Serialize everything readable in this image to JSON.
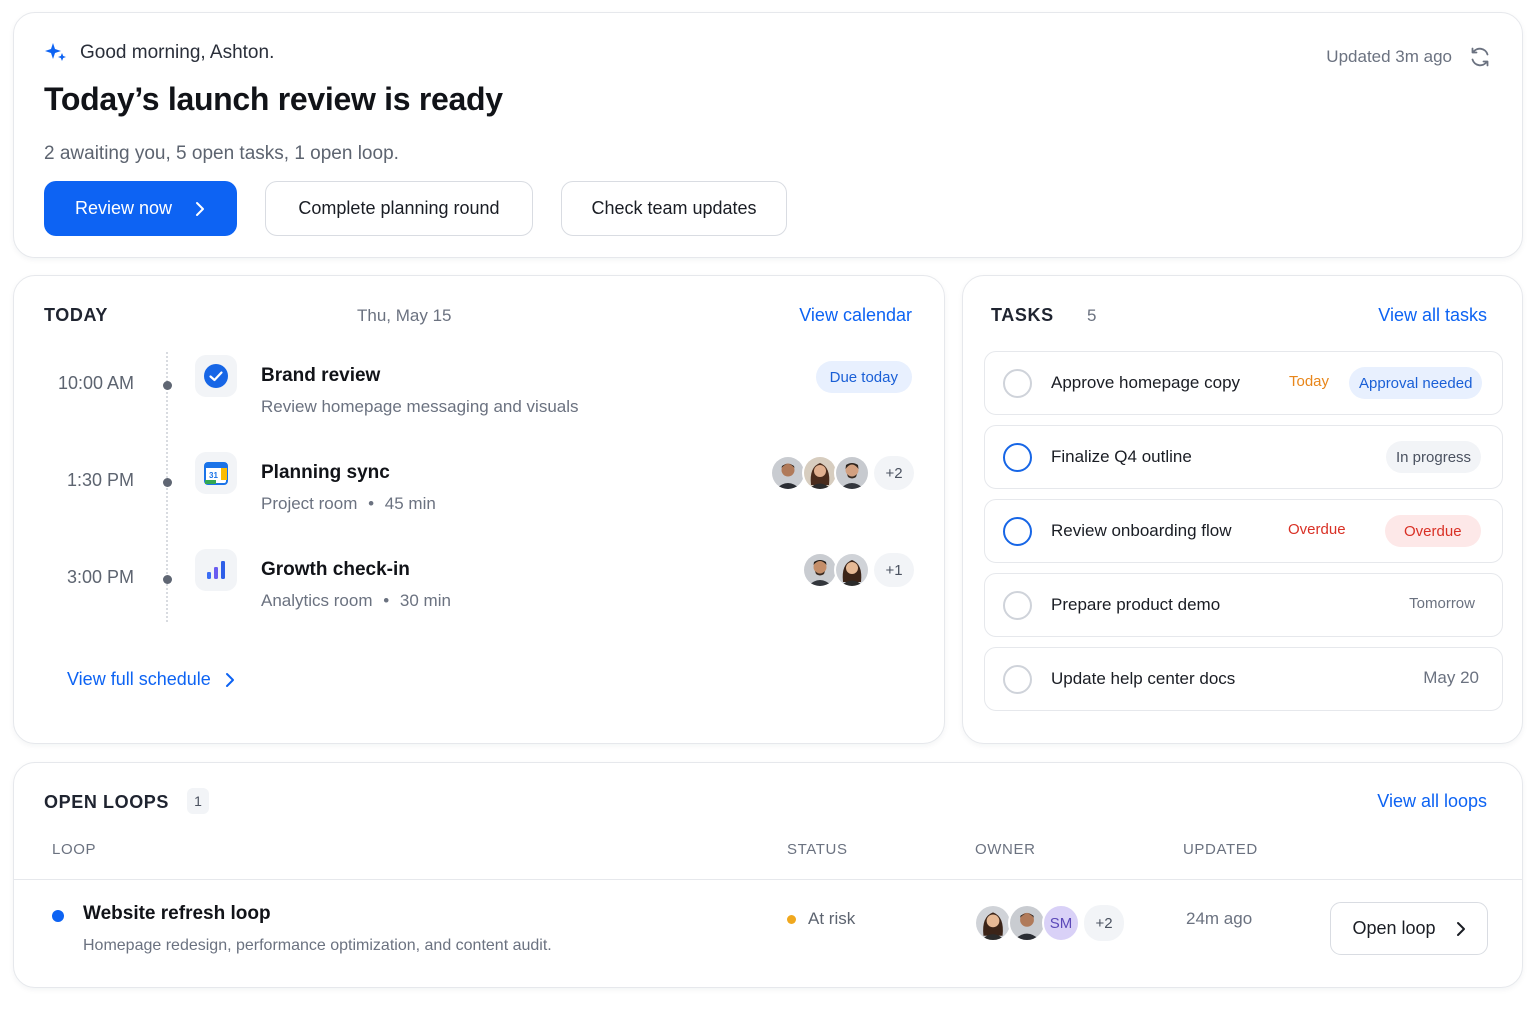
{
  "hero": {
    "greeting": "Good morning, Ashton.",
    "title": "Today’s launch review is ready",
    "subtitle": "2 awaiting you, 5 open tasks, 1 open loop.",
    "updated": "Updated 3m ago",
    "primary_button": "Review now",
    "secondary_buttons": [
      "Complete planning round",
      "Check team updates"
    ],
    "accent": "#0d63f3"
  },
  "today": {
    "title": "TODAY",
    "date": "Thu, May 15",
    "link": "View calendar",
    "events": [
      {
        "time": "10:00 AM",
        "title": "Brand review",
        "subtitle": "Review homepage messaging and visuals",
        "badge": "Due today",
        "icon": "check-circle-icon"
      },
      {
        "time": "1:30 PM",
        "title": "Planning sync",
        "location": "Project room",
        "sep": "•",
        "duration": "45 min",
        "more": "+2",
        "icon": "calendar-icon",
        "calendar_day": "31"
      },
      {
        "time": "3:00 PM",
        "title": "Growth check-in",
        "location": "Analytics room",
        "sep": "•",
        "duration": "30 min",
        "more": "+1",
        "icon": "bar-chart-icon"
      }
    ],
    "footer_link": "View full schedule"
  },
  "tasks": {
    "title": "TASKS",
    "count": "5",
    "link": "View all tasks",
    "items": [
      {
        "label": "Approve homepage copy",
        "due": "Today",
        "tag": "Approval needed"
      },
      {
        "label": "Finalize Q4 outline",
        "tag": "In progress"
      },
      {
        "label": "Review onboarding flow",
        "due": "Overdue",
        "tag": "Overdue"
      },
      {
        "label": "Prepare product demo",
        "due": "Tomorrow"
      },
      {
        "label": "Update help center docs",
        "due": "May 20"
      }
    ],
    "colors": {
      "today": "#e8861a",
      "overdue": "#d93025",
      "approval_bg": "#e8f0fe",
      "overdue_bg": "#fde8e8"
    }
  },
  "loops": {
    "title": "OPEN LOOPS",
    "count": "1",
    "link": "View all loops",
    "columns": [
      "LOOP",
      "STATUS",
      "OWNER",
      "UPDATED"
    ],
    "rows": [
      {
        "title": "Website refresh loop",
        "subtitle": "Homepage redesign, performance optimization, and content audit.",
        "status": "At risk",
        "owner_initials": "SM",
        "owner_more": "+2",
        "updated": "24m ago",
        "action": "Open loop"
      }
    ],
    "status_color": "#f0a81e"
  }
}
